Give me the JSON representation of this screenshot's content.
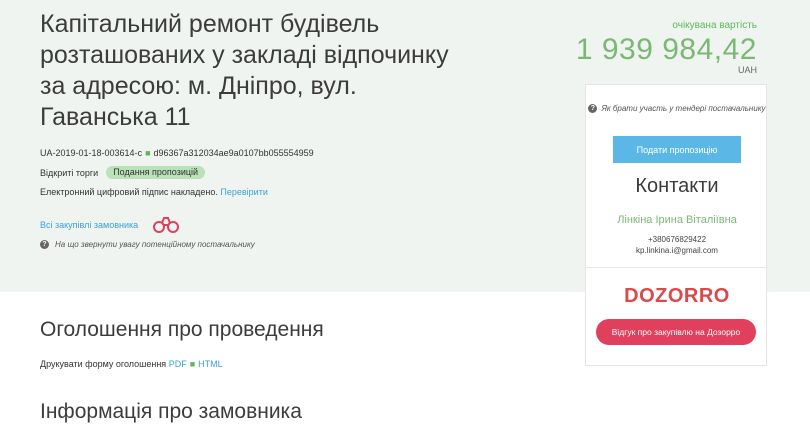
{
  "tender": {
    "title": "Капітальний ремонт будівель розташованих у закладі відпочинку за адресою: м. Дніпро, вул. Гаванська 11",
    "id": "UA-2019-01-18-003614-c",
    "hash": "d96367a312034ae9a0107bb055554959",
    "procedure": "Відкриті торги",
    "status_badge": "Подання пропозицій",
    "signature_text": "Електронний цифровий підпис накладено.",
    "signature_link": "Перевірити",
    "all_purchases_link": "Всі закупівлі замовника",
    "attention_note": "На що звернути увагу потенційному постачальнику"
  },
  "price": {
    "label": "очікувана вартість",
    "amount": "1 939 984,42",
    "currency": "UAH"
  },
  "panel": {
    "how_to_participate": "Як брати участь у тендері постачальнику",
    "submit_offer_button": "Подати пропозицію",
    "contacts_title": "Контакти",
    "contact_name": "Лінкіна Ірина Віталіївна",
    "contact_phone": "+380676829422",
    "contact_email": "kp.linkina.i@gmail.com",
    "logo_text": "DOZORRO",
    "feedback_button": "Відгук про закупівлю на Дозорро"
  },
  "sections": {
    "announcement_title": "Оголошення про проведення",
    "print_label": "Друкувати форму оголошення",
    "print_pdf": "PDF",
    "print_html": "HTML",
    "customer_info_title": "Інформація про замовника"
  },
  "icons": {
    "binoculars": "binoculars-icon",
    "question": "question-icon"
  },
  "colors": {
    "accent_green": "#5cb85c",
    "price_green": "#7bb874",
    "link_blue": "#3aa0d6",
    "button_blue": "#5bb8e6",
    "dozorro_red": "#e0405c"
  }
}
